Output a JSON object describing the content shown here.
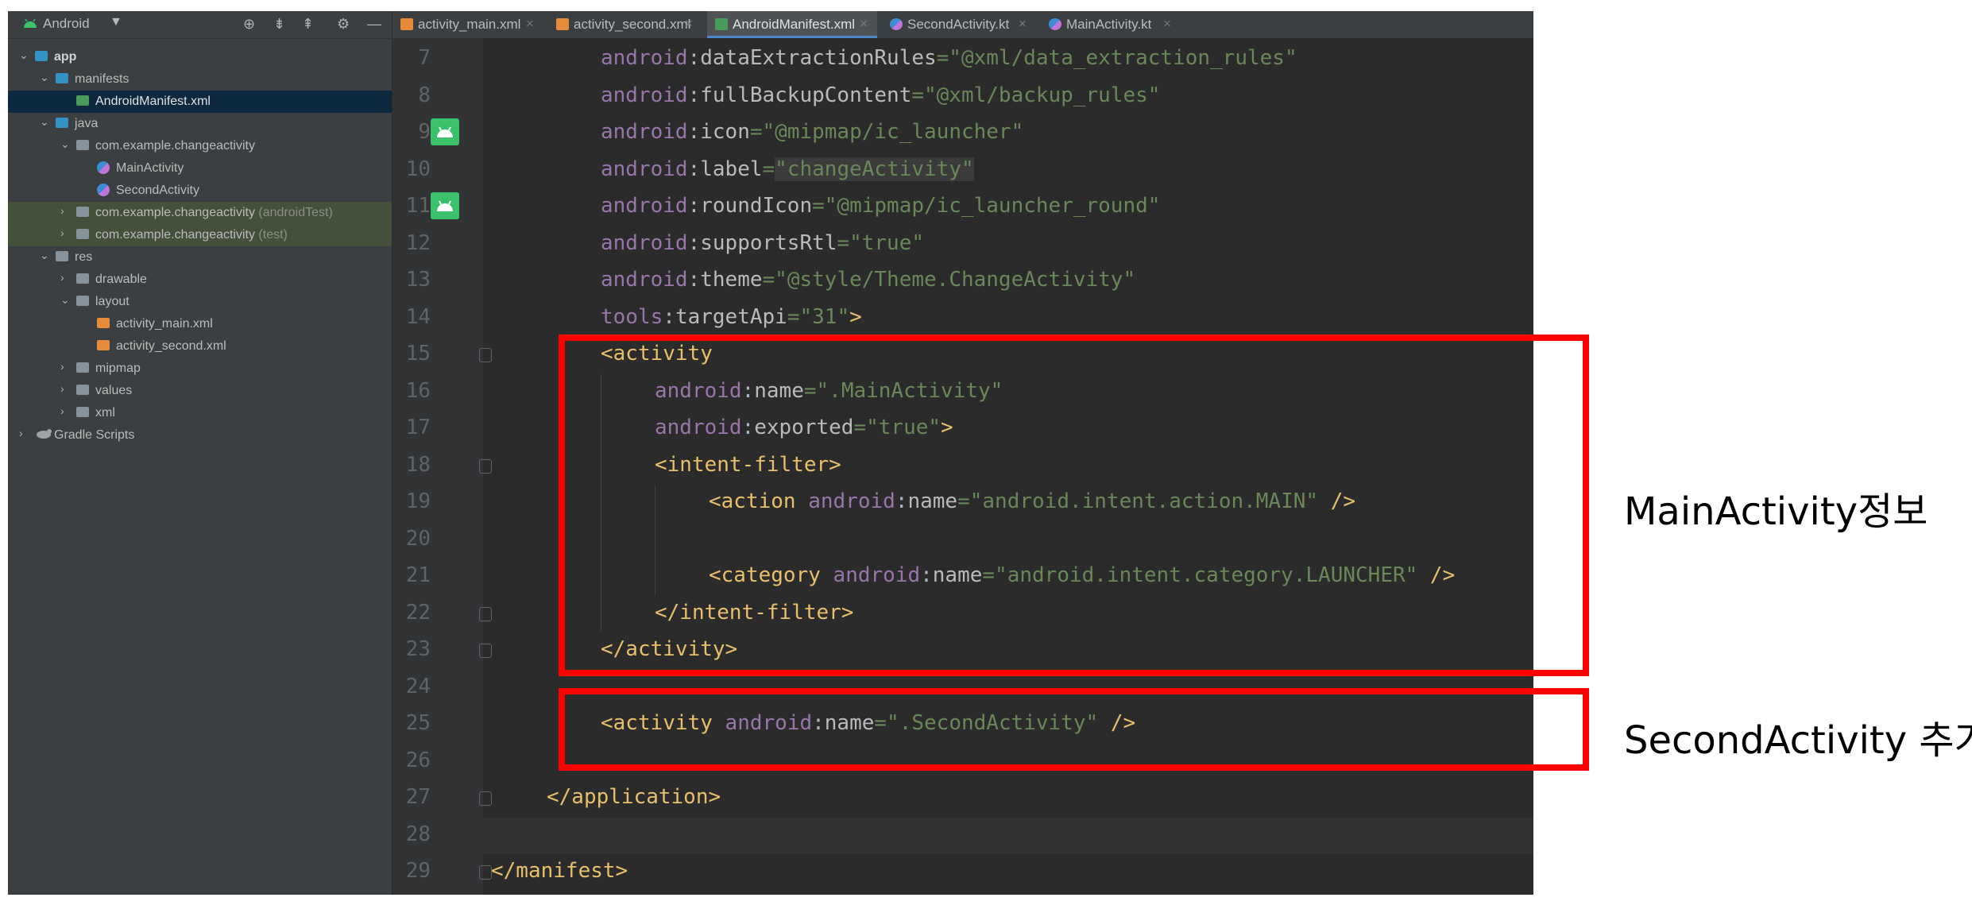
{
  "project_panel": {
    "title": "Android",
    "tree": [
      {
        "label": "app",
        "suffix": ""
      },
      {
        "label": "manifests",
        "suffix": ""
      },
      {
        "label": "AndroidManifest.xml",
        "suffix": ""
      },
      {
        "label": "java",
        "suffix": ""
      },
      {
        "label": "com.example.changeactivity",
        "suffix": ""
      },
      {
        "label": "MainActivity",
        "suffix": ""
      },
      {
        "label": "SecondActivity",
        "suffix": ""
      },
      {
        "label": "com.example.changeactivity",
        "suffix": " (androidTest)"
      },
      {
        "label": "com.example.changeactivity",
        "suffix": " (test)"
      },
      {
        "label": "res",
        "suffix": ""
      },
      {
        "label": "drawable",
        "suffix": ""
      },
      {
        "label": "layout",
        "suffix": ""
      },
      {
        "label": "activity_main.xml",
        "suffix": ""
      },
      {
        "label": "activity_second.xml",
        "suffix": ""
      },
      {
        "label": "mipmap",
        "suffix": ""
      },
      {
        "label": "values",
        "suffix": ""
      },
      {
        "label": "xml",
        "suffix": ""
      },
      {
        "label": "Gradle Scripts",
        "suffix": ""
      }
    ]
  },
  "tabs": [
    {
      "label": "activity_main.xml",
      "icon": "xml-file-icon"
    },
    {
      "label": "activity_second.xml",
      "icon": "xml-file-icon"
    },
    {
      "label": "AndroidManifest.xml",
      "icon": "manifest-file-icon",
      "active": true
    },
    {
      "label": "SecondActivity.kt",
      "icon": "kotlin-file-icon"
    },
    {
      "label": "MainActivity.kt",
      "icon": "kotlin-file-icon"
    }
  ],
  "editor": {
    "lines": [
      {
        "num": "7",
        "tokens": [
          [
            "ns",
            "android"
          ],
          [
            "plain",
            ":"
          ],
          [
            "attr",
            "dataExtractionRules"
          ],
          [
            "str",
            "=\"@xml/data_extraction_rules\""
          ]
        ]
      },
      {
        "num": "8",
        "tokens": [
          [
            "ns",
            "android"
          ],
          [
            "plain",
            ":"
          ],
          [
            "attr",
            "fullBackupContent"
          ],
          [
            "str",
            "=\"@xml/backup_rules\""
          ]
        ]
      },
      {
        "num": "9",
        "tokens": [
          [
            "ns",
            "android"
          ],
          [
            "plain",
            ":"
          ],
          [
            "attr",
            "icon"
          ],
          [
            "str",
            "=\"@mipmap/ic_launcher\""
          ]
        ]
      },
      {
        "num": "10",
        "tokens": [
          [
            "ns",
            "android"
          ],
          [
            "plain",
            ":"
          ],
          [
            "attr",
            "label"
          ],
          [
            "str",
            "="
          ],
          [
            "strhl",
            "\"changeActivity\""
          ]
        ]
      },
      {
        "num": "11",
        "tokens": [
          [
            "ns",
            "android"
          ],
          [
            "plain",
            ":"
          ],
          [
            "attr",
            "roundIcon"
          ],
          [
            "str",
            "=\"@mipmap/ic_launcher_round\""
          ]
        ]
      },
      {
        "num": "12",
        "tokens": [
          [
            "ns",
            "android"
          ],
          [
            "plain",
            ":"
          ],
          [
            "attr",
            "supportsRtl"
          ],
          [
            "str",
            "=\"true\""
          ]
        ]
      },
      {
        "num": "13",
        "tokens": [
          [
            "ns",
            "android"
          ],
          [
            "plain",
            ":"
          ],
          [
            "attr",
            "theme"
          ],
          [
            "str",
            "=\"@style/Theme.ChangeActivity\""
          ]
        ]
      },
      {
        "num": "14",
        "tokens": [
          [
            "ns",
            "tools"
          ],
          [
            "plain",
            ":"
          ],
          [
            "attr",
            "targetApi"
          ],
          [
            "str",
            "=\"31\""
          ],
          [
            "tag",
            ">"
          ]
        ]
      },
      {
        "num": "15",
        "tokens": [
          [
            "tag",
            "<activity"
          ]
        ]
      },
      {
        "num": "16",
        "tokens": [
          [
            "ns",
            "android"
          ],
          [
            "plain",
            ":"
          ],
          [
            "attr",
            "name"
          ],
          [
            "str",
            "=\".MainActivity\""
          ]
        ]
      },
      {
        "num": "17",
        "tokens": [
          [
            "ns",
            "android"
          ],
          [
            "plain",
            ":"
          ],
          [
            "attr",
            "exported"
          ],
          [
            "str",
            "=\"true\""
          ],
          [
            "tag",
            ">"
          ]
        ]
      },
      {
        "num": "18",
        "tokens": [
          [
            "tag",
            "<intent-filter>"
          ]
        ]
      },
      {
        "num": "19",
        "tokens": [
          [
            "tag",
            "<action "
          ],
          [
            "ns",
            "android"
          ],
          [
            "plain",
            ":"
          ],
          [
            "attr",
            "name"
          ],
          [
            "str",
            "=\"android.intent.action.MAIN\""
          ],
          [
            "tag",
            " />"
          ]
        ]
      },
      {
        "num": "20",
        "tokens": []
      },
      {
        "num": "21",
        "tokens": [
          [
            "tag",
            "<category "
          ],
          [
            "ns",
            "android"
          ],
          [
            "plain",
            ":"
          ],
          [
            "attr",
            "name"
          ],
          [
            "str",
            "=\"android.intent.category.LAUNCHER\""
          ],
          [
            "tag",
            " />"
          ]
        ]
      },
      {
        "num": "22",
        "tokens": [
          [
            "tag",
            "</intent-filter>"
          ]
        ]
      },
      {
        "num": "23",
        "tokens": [
          [
            "tag",
            "</activity>"
          ]
        ]
      },
      {
        "num": "24",
        "tokens": []
      },
      {
        "num": "25",
        "tokens": [
          [
            "tag",
            "<activity "
          ],
          [
            "ns",
            "android"
          ],
          [
            "plain",
            ":"
          ],
          [
            "attr",
            "name"
          ],
          [
            "str",
            "=\".SecondActivity\""
          ],
          [
            "tag",
            " />"
          ]
        ]
      },
      {
        "num": "26",
        "tokens": []
      },
      {
        "num": "27",
        "tokens": [
          [
            "tag",
            "</application>"
          ]
        ]
      },
      {
        "num": "28",
        "tokens": []
      },
      {
        "num": "29",
        "tokens": [
          [
            "tag",
            "</manifest>"
          ]
        ]
      }
    ]
  },
  "annotations": {
    "main_activity": "MainActivity정보",
    "second_activity": "SecondActivity 추가"
  },
  "colors": {
    "annotation_box": "#ff0000",
    "xml_namespace": "#9876aa",
    "xml_string": "#6a8759",
    "xml_tag": "#e8bf6a"
  }
}
